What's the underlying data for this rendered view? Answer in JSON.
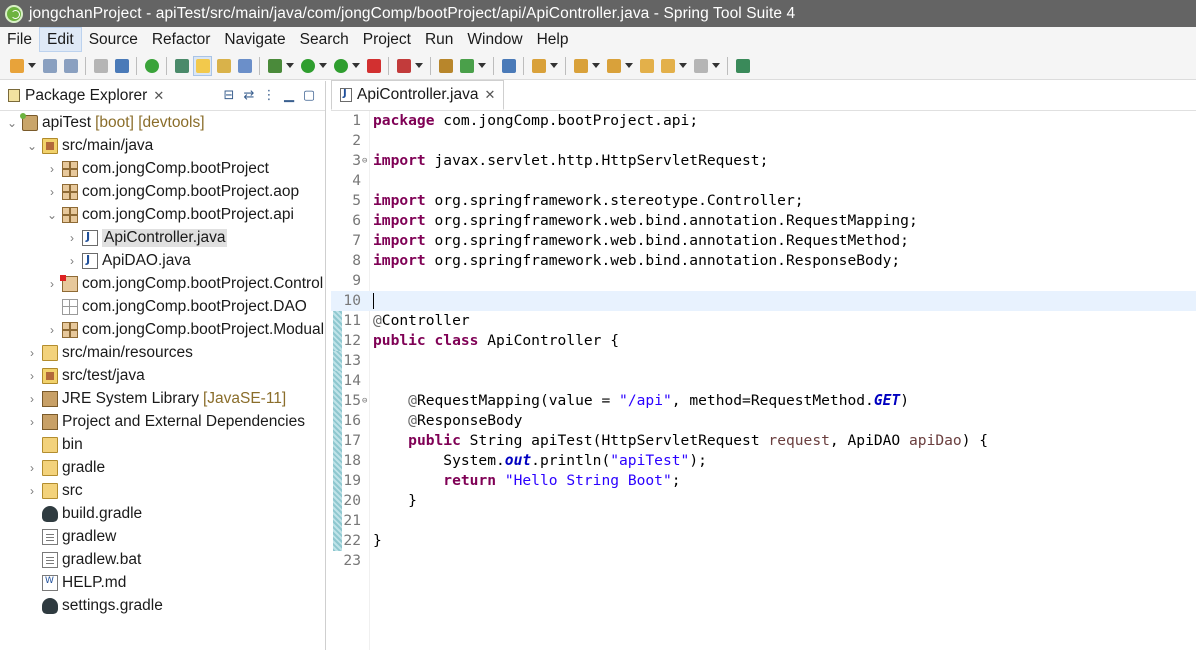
{
  "window": {
    "title": "jongchanProject - apiTest/src/main/java/com/jongComp/bootProject/api/ApiController.java - Spring Tool Suite 4"
  },
  "menu": [
    "File",
    "Edit",
    "Source",
    "Refactor",
    "Navigate",
    "Search",
    "Project",
    "Run",
    "Window",
    "Help"
  ],
  "menu_active": "Edit",
  "toolbar": {
    "icons": [
      "new-wizard-icon",
      "save-icon",
      "save-all-icon",
      "print-icon",
      "open-task-icon",
      "spring-boot-dashboard-icon",
      "toggle-breadcrumb-icon",
      "toggle-mark-occurrences-icon",
      "toggle-block-selection-icon",
      "show-whitespace-icon",
      "debug-icon",
      "run-icon",
      "coverage-icon",
      "stop-icon",
      "external-tools-icon",
      "open-type-icon",
      "new-java-class-icon",
      "open-task-icon",
      "search-icon",
      "next-annotation-icon",
      "previous-annotation-icon",
      "last-edit-location-icon",
      "back-icon",
      "forward-icon",
      "open-perspective-icon"
    ]
  },
  "explorer": {
    "tab_label": "Package Explorer",
    "tree": [
      {
        "label": "apiTest",
        "decor": "[boot] [devtools]",
        "icon": "project-icon",
        "twisty": "expanded"
      },
      {
        "label": "src/main/java",
        "icon": "source-folder-icon",
        "twisty": "expanded"
      },
      {
        "label": "com.jongComp.bootProject",
        "icon": "package-icon",
        "twisty": "collapsed"
      },
      {
        "label": "com.jongComp.bootProject.aop",
        "icon": "package-icon",
        "twisty": "collapsed"
      },
      {
        "label": "com.jongComp.bootProject.api",
        "icon": "package-icon",
        "twisty": "expanded"
      },
      {
        "label": "ApiController.java",
        "icon": "java-file-icon",
        "twisty": "collapsed",
        "selected": true
      },
      {
        "label": "ApiDAO.java",
        "icon": "java-file-icon",
        "twisty": "collapsed"
      },
      {
        "label": "com.jongComp.bootProject.Control",
        "icon": "package-error-icon",
        "twisty": "collapsed"
      },
      {
        "label": "com.jongComp.bootProject.DAO",
        "icon": "empty-package-icon",
        "twisty": "none"
      },
      {
        "label": "com.jongComp.bootProject.Modual",
        "icon": "package-icon",
        "twisty": "collapsed"
      },
      {
        "label": "src/main/resources",
        "icon": "folder-icon",
        "twisty": "collapsed"
      },
      {
        "label": "src/test/java",
        "icon": "source-folder-icon",
        "twisty": "collapsed"
      },
      {
        "label": "JRE System Library",
        "decor": "[JavaSE-11]",
        "icon": "library-icon",
        "twisty": "collapsed"
      },
      {
        "label": "Project and External Dependencies",
        "icon": "library-icon",
        "twisty": "collapsed"
      },
      {
        "label": "bin",
        "icon": "folder-icon",
        "twisty": "none"
      },
      {
        "label": "gradle",
        "icon": "folder-icon",
        "twisty": "collapsed"
      },
      {
        "label": "src",
        "icon": "folder-icon",
        "twisty": "collapsed"
      },
      {
        "label": "build.gradle",
        "icon": "gradle-icon",
        "twisty": "none"
      },
      {
        "label": "gradlew",
        "icon": "file-icon",
        "twisty": "none"
      },
      {
        "label": "gradlew.bat",
        "icon": "file-icon",
        "twisty": "none"
      },
      {
        "label": "HELP.md",
        "icon": "markdown-file-icon",
        "twisty": "none"
      },
      {
        "label": "settings.gradle",
        "icon": "gradle-icon",
        "twisty": "none"
      }
    ]
  },
  "editor": {
    "tab_label": "ApiController.java",
    "lines": [
      {
        "n": "1",
        "text": "package com.jongComp.bootProject.api;"
      },
      {
        "n": "2",
        "text": ""
      },
      {
        "n": "3",
        "text": "import javax.servlet.http.HttpServletRequest;"
      },
      {
        "n": "4",
        "text": ""
      },
      {
        "n": "5",
        "text": "import org.springframework.stereotype.Controller;"
      },
      {
        "n": "6",
        "text": "import org.springframework.web.bind.annotation.RequestMapping;"
      },
      {
        "n": "7",
        "text": "import org.springframework.web.bind.annotation.RequestMethod;"
      },
      {
        "n": "8",
        "text": "import org.springframework.web.bind.annotation.ResponseBody;"
      },
      {
        "n": "9",
        "text": ""
      },
      {
        "n": "10",
        "text": ""
      },
      {
        "n": "11",
        "text": "@Controller"
      },
      {
        "n": "12",
        "text": "public class ApiController {"
      },
      {
        "n": "13",
        "text": ""
      },
      {
        "n": "14",
        "text": ""
      },
      {
        "n": "15",
        "text": "    @RequestMapping(value = \"/api\", method=RequestMethod.GET)"
      },
      {
        "n": "16",
        "text": "    @ResponseBody"
      },
      {
        "n": "17",
        "text": "    public String apiTest(HttpServletRequest request, ApiDAO apiDao) {"
      },
      {
        "n": "18",
        "text": "        System.out.println(\"apiTest\");"
      },
      {
        "n": "19",
        "text": "        return \"Hello String Boot\";"
      },
      {
        "n": "20",
        "text": "    }"
      },
      {
        "n": "21",
        "text": ""
      },
      {
        "n": "22",
        "text": "}"
      },
      {
        "n": "23",
        "text": ""
      }
    ],
    "current_line": "10"
  }
}
